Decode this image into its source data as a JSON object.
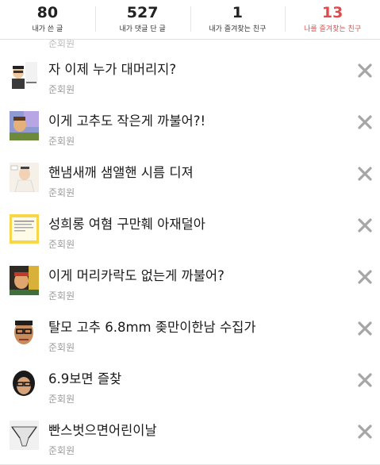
{
  "stats": [
    {
      "count": "80",
      "label": "내가 쓴 글"
    },
    {
      "count": "527",
      "label": "내가 댓글 단 글"
    },
    {
      "count": "1",
      "label": "내가 즐겨찾는 친구"
    },
    {
      "count": "13",
      "label": "나를 즐겨찾는 친구"
    }
  ],
  "list_partial_author": "준회원",
  "items": [
    {
      "title": "자 이제 누가 대머리지?",
      "author": "준회원"
    },
    {
      "title": "이게 고추도 작은게 까불어?!",
      "author": "준회원"
    },
    {
      "title": "핸냄새깨 샘앨핸 시름 디져",
      "author": "준회원"
    },
    {
      "title": "성희롱 여혐 구만훼 아재덜아",
      "author": "준회원"
    },
    {
      "title": "이게 머리카락도 없는게 까불어?",
      "author": "준회원"
    },
    {
      "title": "탈모 고추 6.8mm 좆만이한남 수집가",
      "author": "준회원"
    },
    {
      "title": "6.9보면 즐찾",
      "author": "준회원"
    },
    {
      "title": "빤스벗으면어린이날",
      "author": "준회원"
    }
  ],
  "colors": {
    "accent": "#e04b4b",
    "delete_icon": "#a6a6a6"
  }
}
